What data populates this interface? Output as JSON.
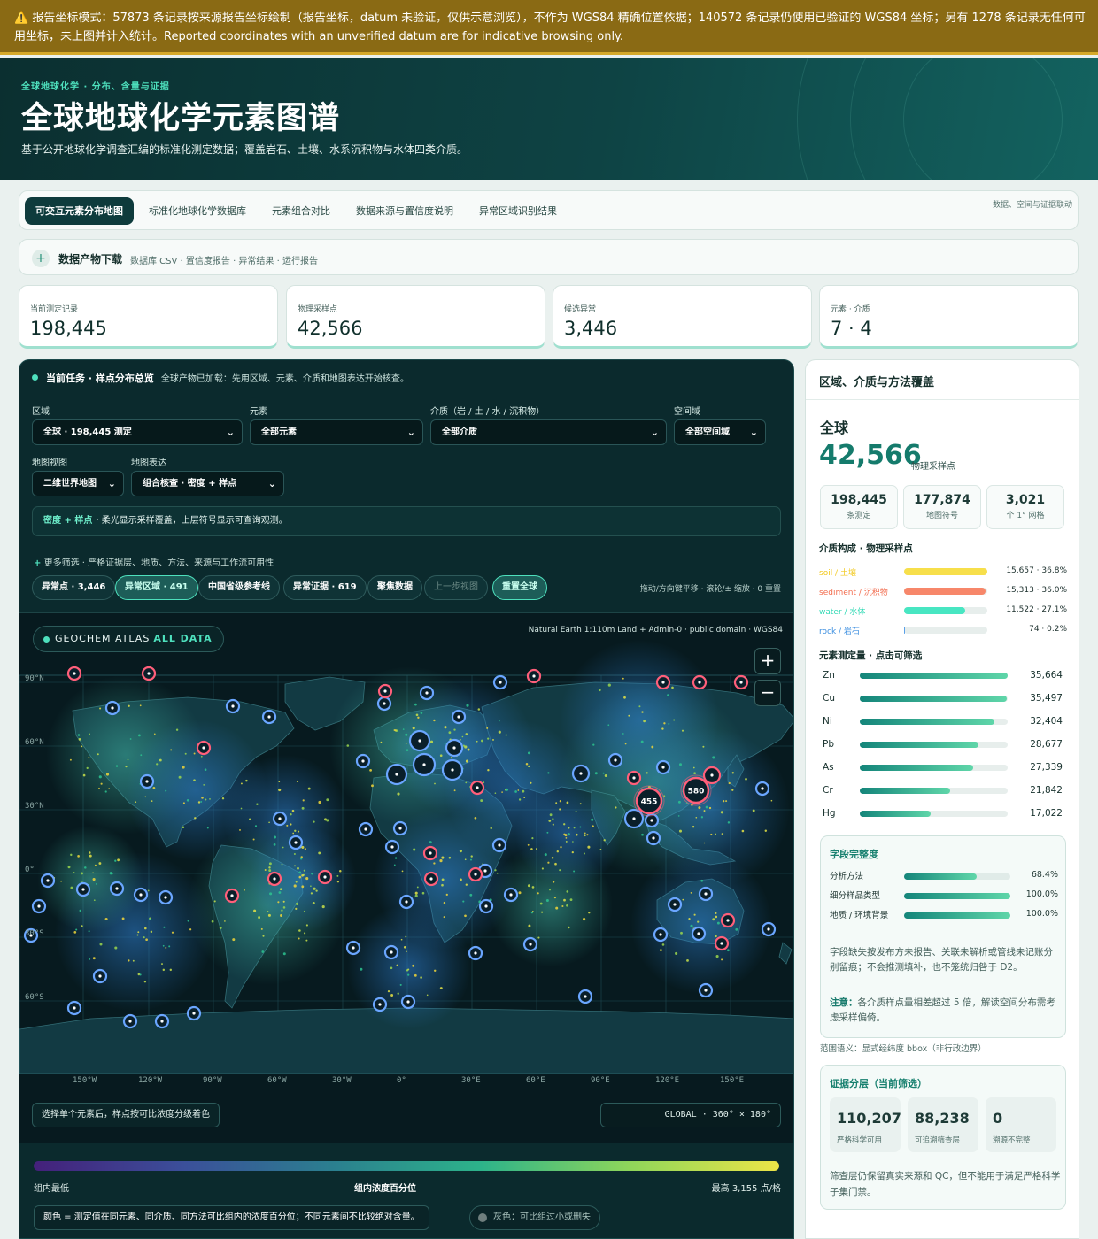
{
  "warning": {
    "icon": "⚠️",
    "text": "报告坐标模式：57873 条记录按来源报告坐标绘制（报告坐标，datum 未验证，仅供示意浏览），不作为 WGS84 精确位置依据；140572 条记录仍使用已验证的 WGS84 坐标；另有 1278 条记录无任何可用坐标，未上图并计入统计。Reported coordinates with an unverified datum are for indicative browsing only."
  },
  "hero": {
    "kicker": "全球地球化学 · 分布、含量与证据",
    "title": "全球地球化学元素图谱",
    "subtitle": "基于公开地球化学调查汇编的标准化测定数据；覆盖岩石、土壤、水系沉积物与水体四类介质。"
  },
  "tabs": {
    "items": [
      "可交互元素分布地图",
      "标准化地球化学数据库",
      "元素组合对比",
      "数据来源与置信度说明",
      "异常区域识别结果"
    ],
    "right_note": "数据、空间与证据联动"
  },
  "downloads": {
    "title": "数据产物下载",
    "links": "数据库 CSV · 置信度报告 · 异常结果 · 运行报告"
  },
  "kpis": [
    {
      "label": "当前测定记录",
      "value": "198,445"
    },
    {
      "label": "物理采样点",
      "value": "42,566"
    },
    {
      "label": "候选异常",
      "value": "3,446"
    },
    {
      "label": "元素 · 介质",
      "value": "7 · 4"
    }
  ],
  "task": {
    "title": "当前任务 · 样点分布总览",
    "message": "全球产物已加载：先用区域、元素、介质和地图表达开始核查。"
  },
  "filters": {
    "region_label": "区域",
    "region_value": "全球 · 198,445 测定",
    "element_label": "元素",
    "element_value": "全部元素",
    "medium_label": "介质（岩 / 土 / 水 / 沉积物）",
    "medium_value": "全部介质",
    "space_label": "空间域",
    "space_value": "全部空间域",
    "view_label": "地图视图",
    "view_value": "二维世界地图",
    "expr_label": "地图表达",
    "expr_value": "组合核查 · 密度 + 样点"
  },
  "note": {
    "strong": "密度 + 样点",
    "text": "· 柔光显示采样覆盖，上层符号显示可查询观测。"
  },
  "more_filters": {
    "plus": "+",
    "text": "更多筛选 · 严格证据层、地质、方法、来源与工作流可用性"
  },
  "chips": [
    {
      "label": "异常点 · 3,446",
      "state": "normal"
    },
    {
      "label": "异常区域 · 491",
      "state": "on"
    },
    {
      "label": "中国省级参考线",
      "state": "normal"
    },
    {
      "label": "异常证据 · 619",
      "state": "normal"
    },
    {
      "label": "聚焦数据",
      "state": "normal"
    },
    {
      "label": "上一步视图",
      "state": "disabled"
    },
    {
      "label": "重置全球",
      "state": "on"
    }
  ],
  "nav_hint": "拖动/方向键平移 · 滚轮/± 缩放 · 0 重置",
  "map": {
    "badge_a": "GEOCHEM ATLAS",
    "badge_b": "ALL DATA",
    "source": "Natural Earth 1:110m Land + Admin-0 · public domain · WGS84",
    "zoom_in": "+",
    "zoom_out": "−",
    "lat_labels": [
      "90°N",
      "60°N",
      "30°N",
      "0°",
      "30°S",
      "60°S"
    ],
    "lon_labels": [
      "150°W",
      "120°W",
      "90°W",
      "60°W",
      "30°W",
      "0°",
      "30°E",
      "60°E",
      "90°E",
      "120°E",
      "150°E"
    ],
    "cluster_labels": [
      "455",
      "580"
    ],
    "hint": "选择单个元素后，样点按可比浓度分级着色",
    "extent": "GLOBAL · 360° × 180°"
  },
  "legend": {
    "low": "组内最低",
    "mid": "组内浓度百分位",
    "high": "最高 3,155 点/格",
    "color_note": "颜色 = 测定值在同元素、同介质、同方法可比组内的浓度百分位；不同元素间不比较绝对含量。",
    "grey_note": "灰色：可比组过小或删失"
  },
  "side": {
    "title": "区域、介质与方法覆盖",
    "region": "全球",
    "big_value": "42,566",
    "big_unit": "物理采样点",
    "mini": [
      {
        "value": "198,445",
        "unit": "条测定"
      },
      {
        "value": "177,874",
        "unit": "地图符号"
      },
      {
        "value": "3,021",
        "unit": "个 1° 网格"
      }
    ],
    "media_title": "介质构成 · 物理采样点",
    "media": [
      {
        "name": "soil / 土壤",
        "value": "15,657 · 36.8%",
        "share": 0.368,
        "color": "#f2c91f",
        "bar": "#f7df4b"
      },
      {
        "name": "sediment / 沉积物",
        "value": "15,313 · 36.0%",
        "share": 0.36,
        "color": "#f26d4f",
        "bar": "#f7876a"
      },
      {
        "name": "water / 水体",
        "value": "11,522 · 27.1%",
        "share": 0.271,
        "color": "#2ed9b4",
        "bar": "#48e6c2"
      },
      {
        "name": "rock / 岩石",
        "value": "74 · 0.2%",
        "share": 0.002,
        "color": "#3d8fe0",
        "bar": "#5aa0e8"
      }
    ],
    "elements_title": "元素测定量 · 点击可筛选",
    "elements": [
      {
        "name": "Zn",
        "value": "35,664",
        "count": 35664
      },
      {
        "name": "Cu",
        "value": "35,497",
        "count": 35497
      },
      {
        "name": "Ni",
        "value": "32,404",
        "count": 32404
      },
      {
        "name": "Pb",
        "value": "28,677",
        "count": 28677
      },
      {
        "name": "As",
        "value": "27,339",
        "count": 27339
      },
      {
        "name": "Cr",
        "value": "21,842",
        "count": 21842
      },
      {
        "name": "Hg",
        "value": "17,022",
        "count": 17022
      }
    ],
    "fields_title": "字段完整度",
    "fields": [
      {
        "name": "分析方法",
        "value": "68.4%",
        "share": 0.684
      },
      {
        "name": "细分样品类型",
        "value": "100.0%",
        "share": 1.0
      },
      {
        "name": "地质 / 环境背景",
        "value": "100.0%",
        "share": 1.0
      }
    ],
    "fields_note": "字段缺失按发布方未报告、关联未解析或管线未记账分别留痕；不会推测填补，也不笼统归咎于 D2。",
    "fields_caution_strong": "注意：",
    "fields_caution": "各介质样点量相差超过 5 倍，解读空间分布需考虑采样偏倚。",
    "scope": "范围语义：显式经纬度 bbox（非行政边界）",
    "evidence_title": "证据分层（当前筛选）",
    "evidence": [
      {
        "value": "110,207",
        "unit": "严格科学可用"
      },
      {
        "value": "88,238",
        "unit": "可追溯筛查层"
      },
      {
        "value": "0",
        "unit": "溯源不完整"
      }
    ],
    "evidence_note": "筛查层仍保留真实来源和 QC，但不能用于满足严格科学子集门禁。"
  }
}
